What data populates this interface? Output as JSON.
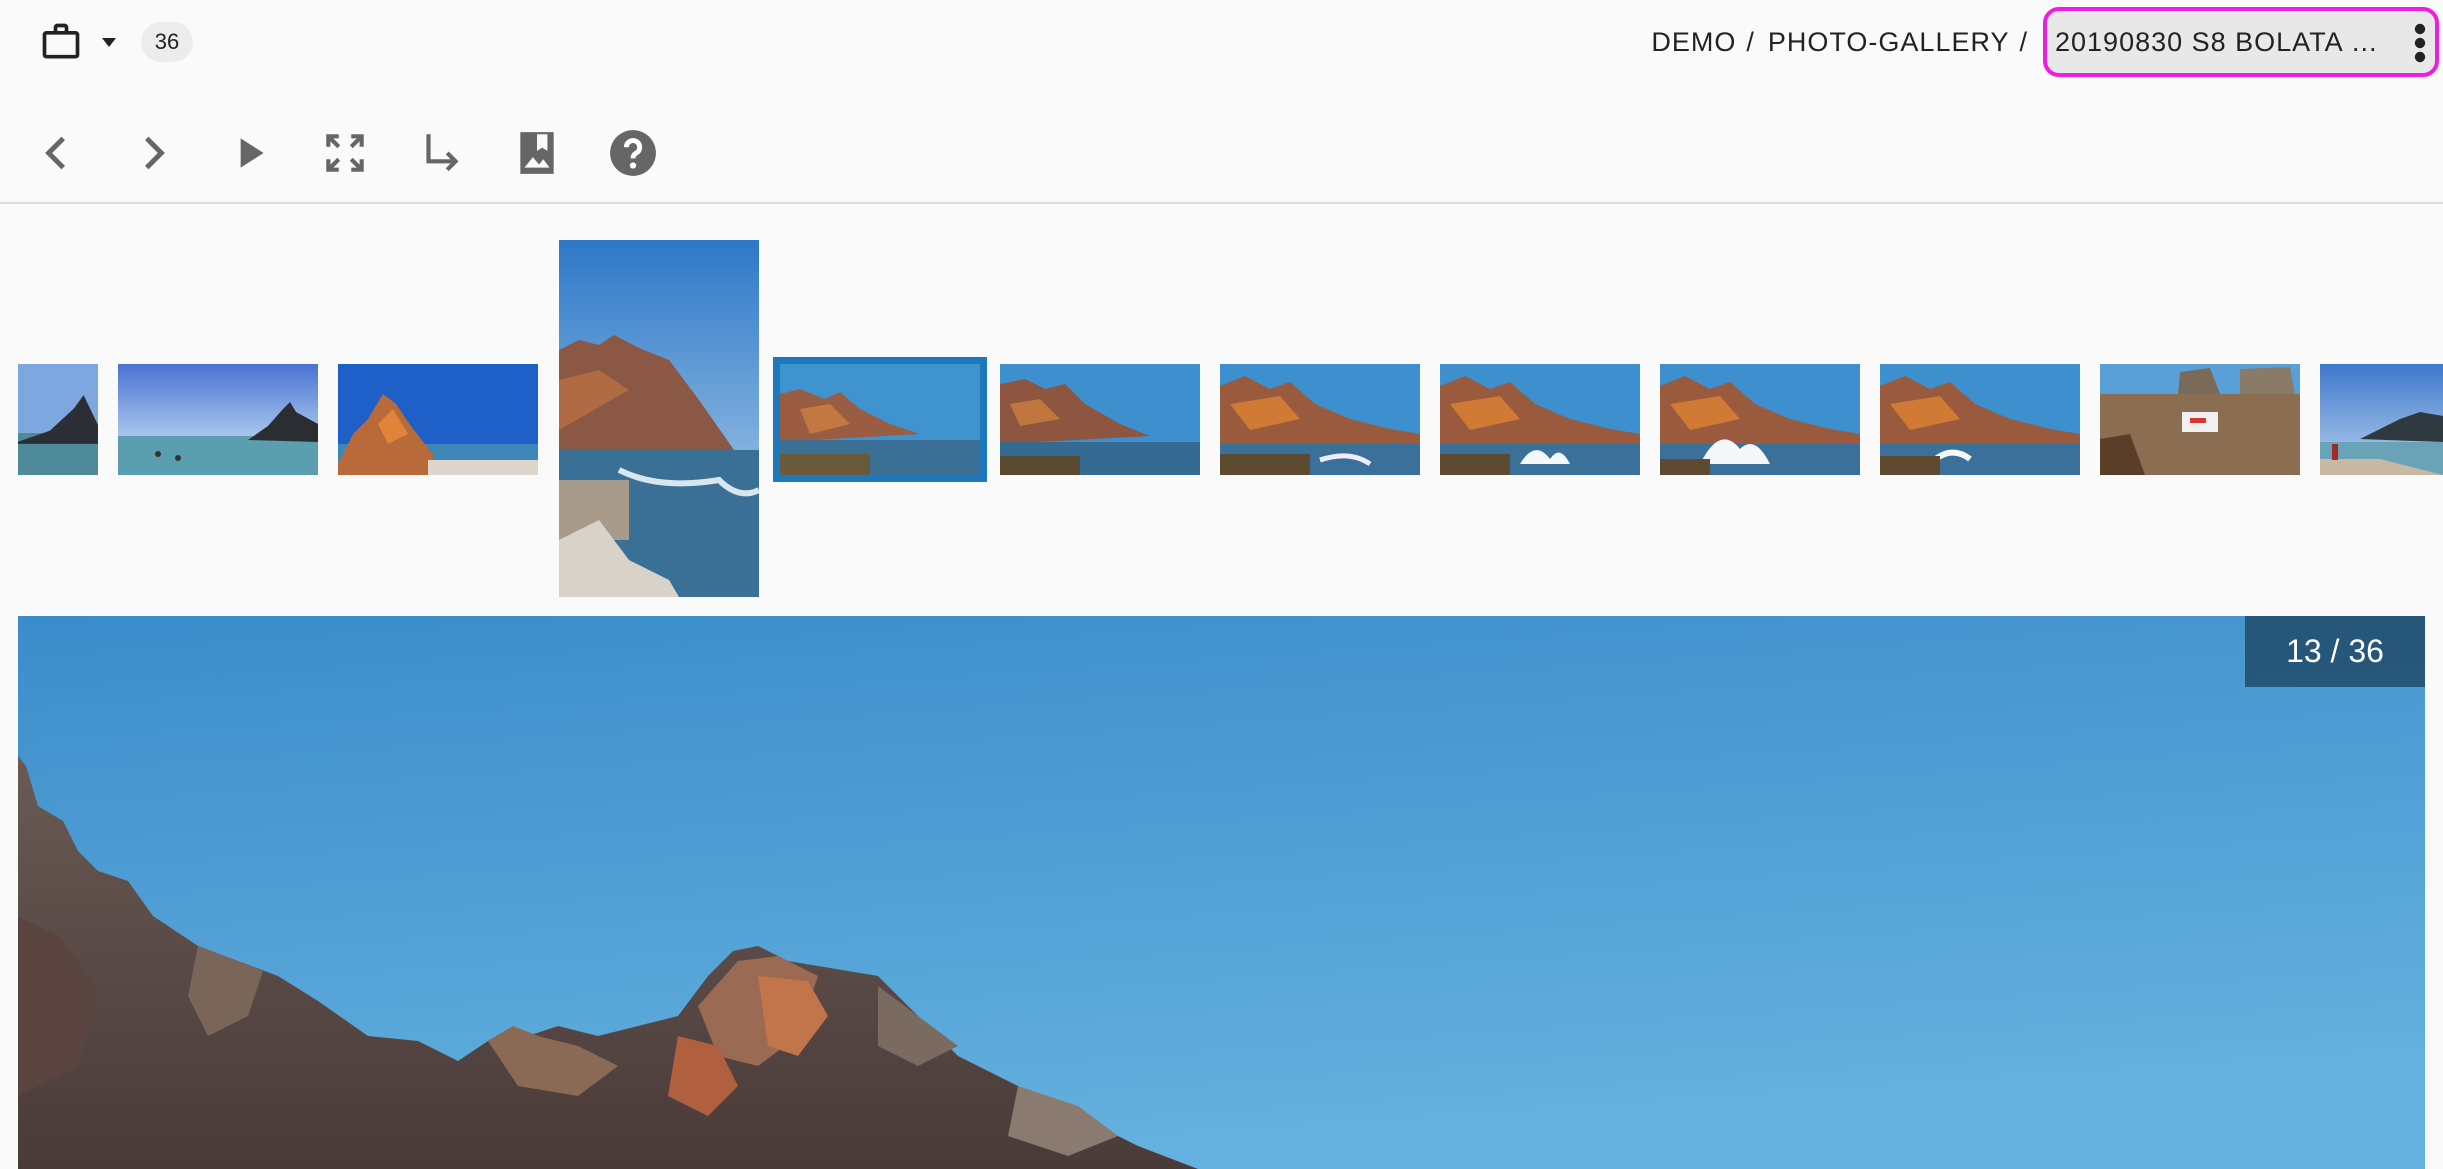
{
  "header": {
    "photo_count": "36",
    "breadcrumb": {
      "items": [
        "DEMO",
        "PHOTO-GALLERY"
      ],
      "separator": "/",
      "current": "20190830 S8 BOLATA B..."
    }
  },
  "toolbar": {
    "buttons": [
      "previous-icon",
      "next-icon",
      "play-icon",
      "fullscreen-icon",
      "go-to-icon",
      "photo-bookmark-icon",
      "help-icon"
    ]
  },
  "viewer": {
    "counter": "13 / 36"
  },
  "colors": {
    "accent": "#1e78bd",
    "highlight": "#ee1ee0",
    "sky": "#3b8ccb"
  }
}
